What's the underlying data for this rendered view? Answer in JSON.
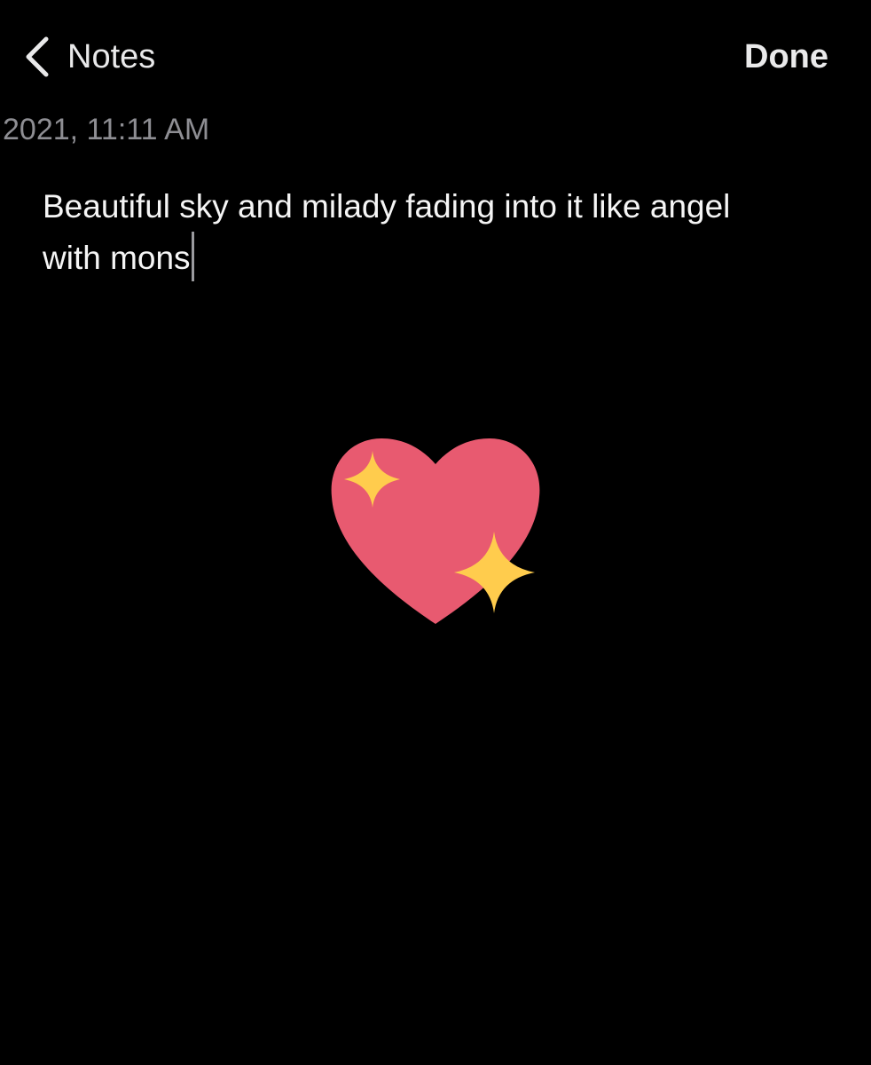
{
  "nav": {
    "back_label": "Notes",
    "done_label": "Done",
    "back_icon": "chevron-left-icon"
  },
  "note": {
    "date": "2021, 11:11 AM",
    "line1": "Beautiful sky and milady fading into it like angel",
    "line2": "with mons"
  },
  "emoji": {
    "icon": "sparkling-heart-icon",
    "heart_color": "#e85a70",
    "sparkle_color": "#ffcc4d"
  },
  "colors": {
    "background": "#000000",
    "text": "#f5f5f5",
    "secondary_text": "#8e8e93"
  }
}
